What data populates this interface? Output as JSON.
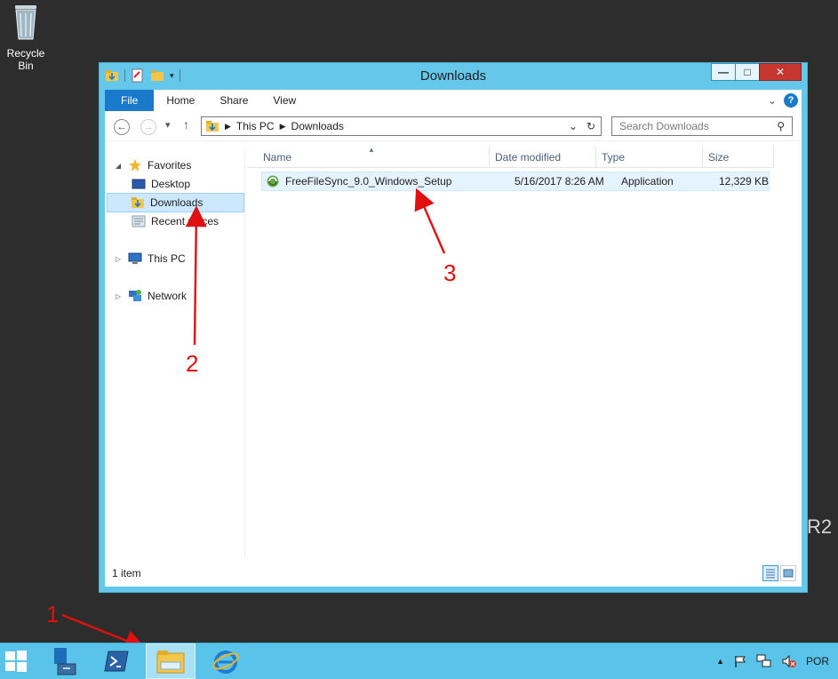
{
  "desktop": {
    "recycle_bin_label": "Recycle Bin",
    "watermark": "R2"
  },
  "window": {
    "title": "Downloads",
    "minimize": "—",
    "maximize": "□",
    "close": "✕"
  },
  "ribbon": {
    "tabs": [
      "File",
      "Home",
      "Share",
      "View"
    ],
    "chevron": "⌄",
    "help": "?"
  },
  "address": {
    "segments": [
      "This PC",
      "Downloads"
    ],
    "dropdown": "⌄",
    "refresh": "↻"
  },
  "search": {
    "placeholder": "Search Downloads",
    "icon": "⚲"
  },
  "nav": {
    "back": "←",
    "forward": "→",
    "recent": "▾",
    "up": "↑",
    "items": {
      "favorites": "Favorites",
      "desktop": "Desktop",
      "downloads": "Downloads",
      "recent_places": "Recent places",
      "this_pc": "This PC",
      "network": "Network"
    }
  },
  "columns": [
    "Name",
    "Date modified",
    "Type",
    "Size"
  ],
  "files": [
    {
      "name": "FreeFileSync_9.0_Windows_Setup",
      "date": "5/16/2017 8:26 AM",
      "type": "Application",
      "size": "12,329 KB"
    }
  ],
  "status": {
    "count": "1 item"
  },
  "annotations": [
    "1",
    "2",
    "3"
  ],
  "taskbar": {
    "language": "POR"
  },
  "colors": {
    "window_frame": "#65c7ea",
    "taskbar": "#5ac3ea",
    "file_tab": "#1979ca",
    "annotation": "#e01010",
    "selection": "#cce8ff"
  }
}
